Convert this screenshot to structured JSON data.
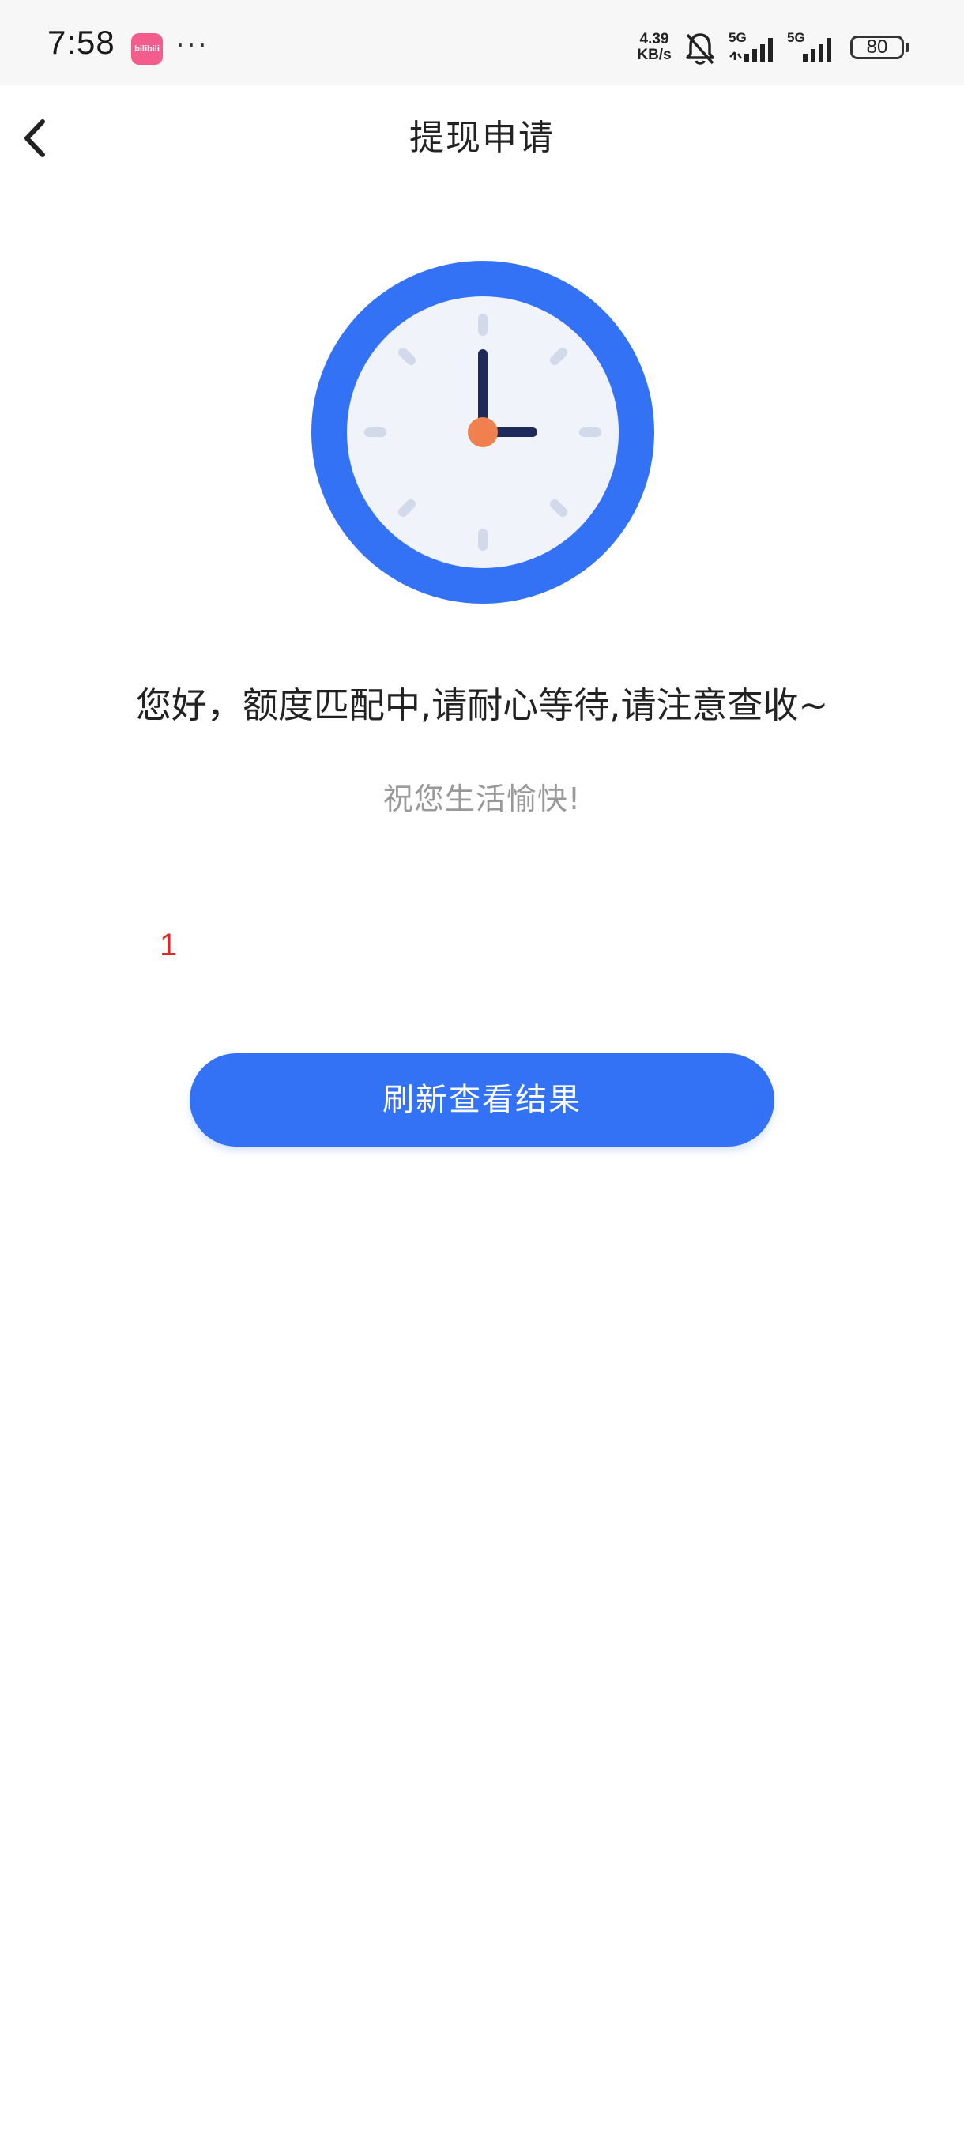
{
  "status_bar": {
    "time": "7:58",
    "app_badge_text": "bilibili",
    "dots": "···",
    "net_speed_value": "4.39",
    "net_speed_unit": "KB/s",
    "signal_1_label": "5G",
    "signal_2_label": "5G",
    "battery": "80",
    "icons": [
      "bell-muted-icon",
      "signal-icon",
      "battery-icon"
    ]
  },
  "nav": {
    "title": "提现申请",
    "back_icon": "chevron-left-icon"
  },
  "illustration": {
    "icon": "clock-icon",
    "colors": {
      "ring": "#3472f5",
      "face": "#f0f3fa",
      "hands": "#1e2a5a",
      "center": "#f0814f",
      "ticks": "#d2d9ea"
    }
  },
  "content": {
    "message": "您好，额度匹配中,请耐心等待,请注意查收~",
    "wish": "祝您生活愉快!",
    "counter": "1"
  },
  "actions": {
    "refresh_label": "刷新查看结果",
    "accent_color": "#3472f5"
  }
}
